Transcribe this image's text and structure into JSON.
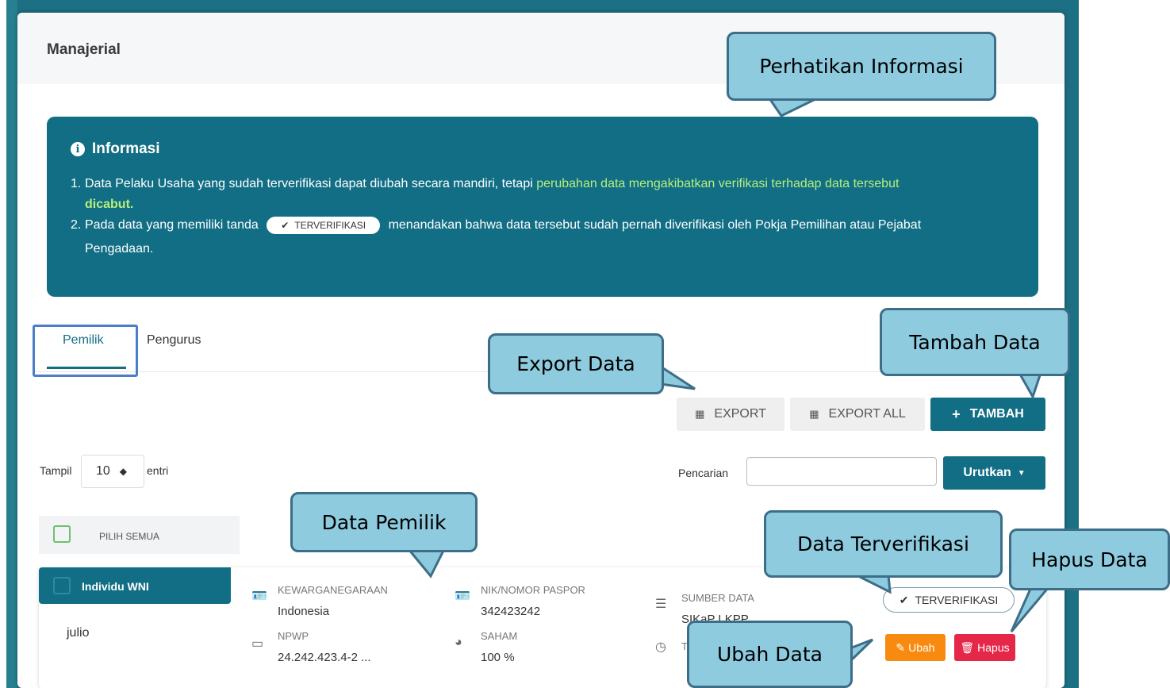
{
  "page": {
    "title": "Manajerial"
  },
  "info": {
    "title": "Informasi",
    "items": [
      {
        "num": "1.",
        "text_a": "Data Pelaku Usaha yang sudah terverifikasi dapat diubah secara mandiri, tetapi ",
        "text_highlight": "perubahan data mengakibatkan verifikasi terhadap data tersebut",
        "text_bold": "dicabut."
      },
      {
        "num": "2.",
        "text_a": "Pada data yang memiliki tanda",
        "badge": "TERVERIFIKASI",
        "text_b": "menandakan bahwa data tersebut sudah pernah diverifikasi oleh Pokja Pemilihan atau Pejabat",
        "text_c": "Pengadaan."
      }
    ]
  },
  "tabs": [
    {
      "label": "Pemilik",
      "active": true
    },
    {
      "label": "Pengurus",
      "active": false
    }
  ],
  "toolbar": {
    "export_label": "EXPORT",
    "export_all_label": "EXPORT ALL",
    "add_label": "TAMBAH"
  },
  "filter": {
    "show_label": "Tampil",
    "show_value": "10",
    "entries_label": "entri",
    "search_label": "Pencarian",
    "search_value": "",
    "sort_label": "Urutkan"
  },
  "select_all_label": "PILIH SEMUA",
  "record": {
    "type": "Individu WNI",
    "name": "julio",
    "fields": {
      "kewarganegaraan_label": "KEWARGANEGARAAN",
      "kewarganegaraan_value": "Indonesia",
      "npwp_label": "NPWP",
      "npwp_value": "24.242.423.4-2 ...",
      "nik_label": "NIK/NOMOR PASPOR",
      "nik_value": "342423242",
      "saham_label": "SAHAM",
      "saham_value": "100 %",
      "sumber_label": "SUMBER DATA",
      "sumber_value": "SIKaP LKPP",
      "time_label": "T"
    },
    "verified_label": "TERVERIFIKASI",
    "edit_label": "Ubah",
    "delete_label": "Hapus"
  },
  "callouts": {
    "perhatikan": "Perhatikan Informasi",
    "export": "Export Data",
    "tambah": "Tambah Data",
    "pemilik": "Data Pemilik",
    "terverifikasi": "Data Terverifikasi",
    "hapus": "Hapus Data",
    "ubah": "Ubah Data"
  },
  "colors": {
    "primary": "#126e84",
    "highlight": "#b6ef7d",
    "edit": "#f98a10",
    "delete": "#e5274a",
    "callout": "#8ecbdf"
  }
}
